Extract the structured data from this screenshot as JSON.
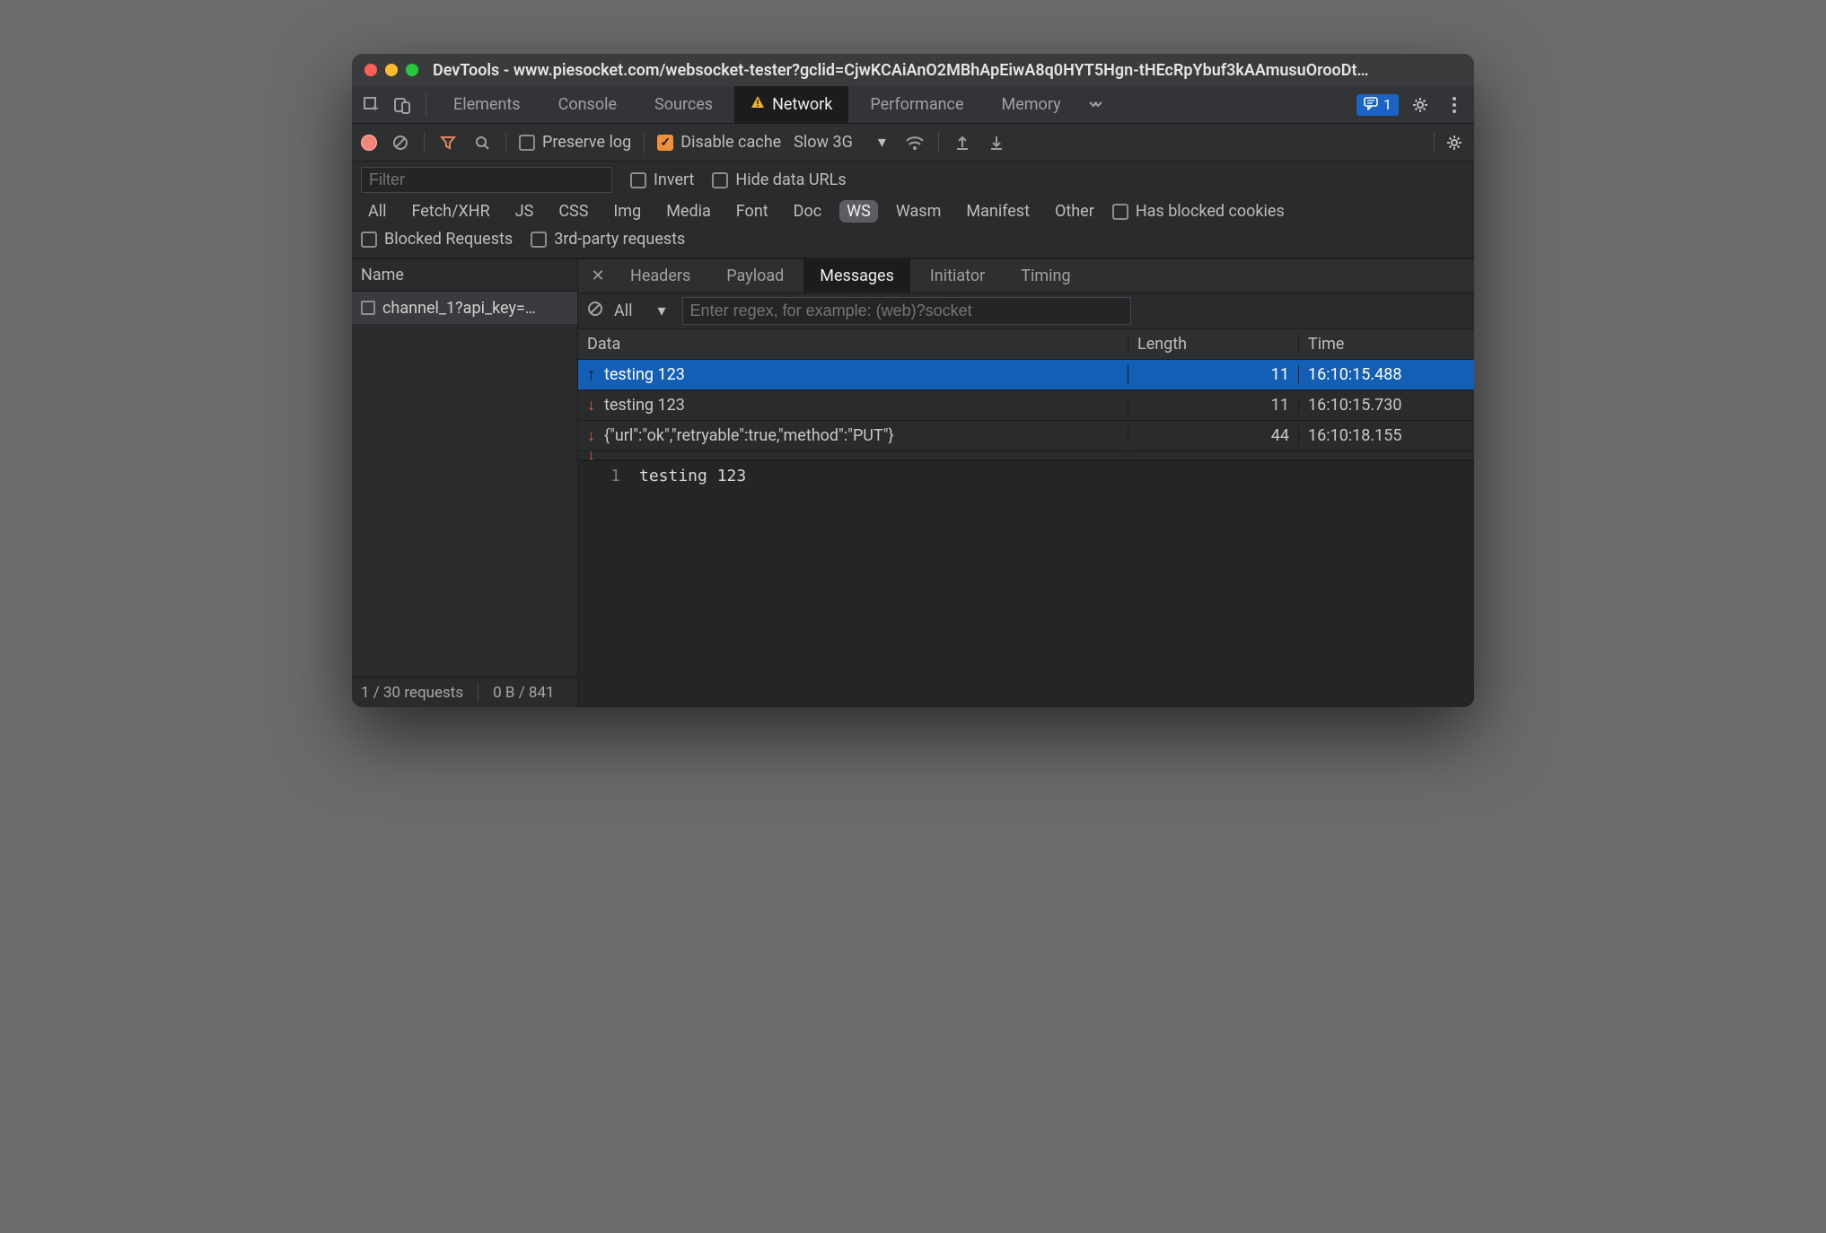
{
  "title": "DevTools - www.piesocket.com/websocket-tester?gclid=CjwKCAiAnO2MBhApEiwA8q0HYT5Hgn-tHEcRpYbuf3kAAmusuOrooDt…",
  "tabs": {
    "elements": "Elements",
    "console": "Console",
    "sources": "Sources",
    "network": "Network",
    "performance": "Performance",
    "memory": "Memory"
  },
  "badge_count": "1",
  "toolbar": {
    "preserve_log": "Preserve log",
    "disable_cache": "Disable cache",
    "throttle": "Slow 3G"
  },
  "filter": {
    "placeholder": "Filter",
    "invert": "Invert",
    "hide_data_urls": "Hide data URLs",
    "types": [
      "All",
      "Fetch/XHR",
      "JS",
      "CSS",
      "Img",
      "Media",
      "Font",
      "Doc",
      "WS",
      "Wasm",
      "Manifest",
      "Other"
    ],
    "has_blocked_cookies": "Has blocked cookies",
    "blocked_requests": "Blocked Requests",
    "third_party": "3rd-party requests"
  },
  "side": {
    "name_label": "Name",
    "request": "channel_1?api_key=…"
  },
  "dtabs": {
    "headers": "Headers",
    "payload": "Payload",
    "messages": "Messages",
    "initiator": "Initiator",
    "timing": "Timing"
  },
  "msgbar": {
    "filter": "All",
    "regex_placeholder": "Enter regex, for example: (web)?socket"
  },
  "msgcols": {
    "data": "Data",
    "length": "Length",
    "time": "Time"
  },
  "messages": [
    {
      "dir": "up",
      "data": "testing 123",
      "length": "11",
      "time": "16:10:15.488"
    },
    {
      "dir": "down",
      "data": "testing 123",
      "length": "11",
      "time": "16:10:15.730"
    },
    {
      "dir": "down",
      "data": "{\"url\":\"ok\",\"retryable\":true,\"method\":\"PUT\"}",
      "length": "44",
      "time": "16:10:18.155"
    }
  ],
  "code": {
    "line_no": "1",
    "content": "testing 123"
  },
  "status": {
    "requests": "1 / 30 requests",
    "bytes": "0 B / 841"
  }
}
